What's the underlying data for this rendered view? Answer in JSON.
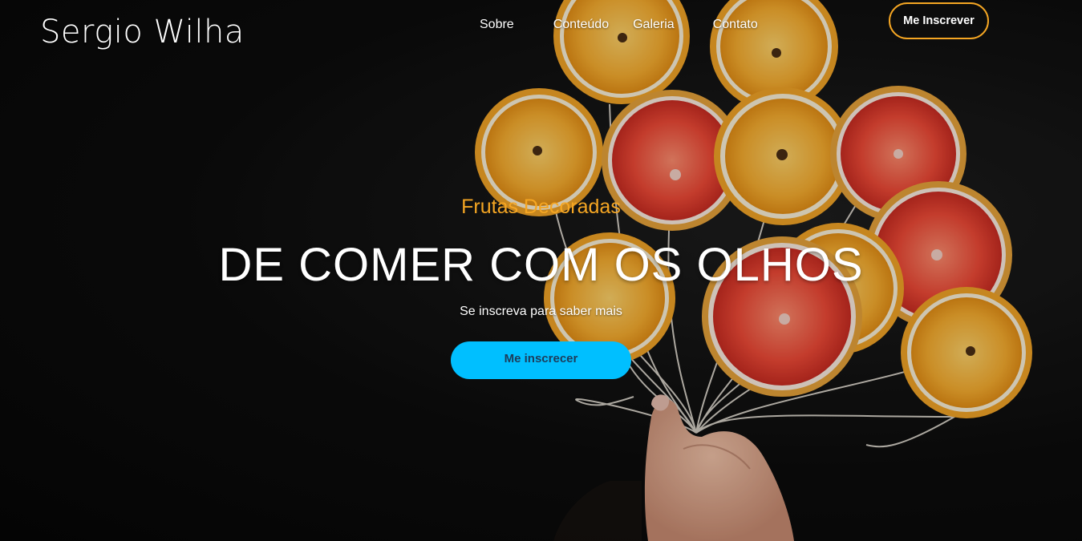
{
  "header": {
    "brand": "Sergio Wilha",
    "nav": [
      {
        "label": "Sobre"
      },
      {
        "label": "Conteúdo"
      },
      {
        "label": "Galeria"
      },
      {
        "label": "Contato"
      }
    ],
    "signup_label": "Me Inscrever"
  },
  "hero": {
    "subtitle": "Frutas Decoradas",
    "headline": "DE COMER COM OS OLHOS",
    "tagline": "Se inscreva para saber mais",
    "cta_label": "Me inscrecer",
    "image": "orange-slice-balloons-held-by-hand"
  },
  "colors": {
    "accent_orange": "#f5a623",
    "cta_blue": "#00bfff",
    "cta_text": "#1d3c5a",
    "background": "#0a0a0a"
  }
}
